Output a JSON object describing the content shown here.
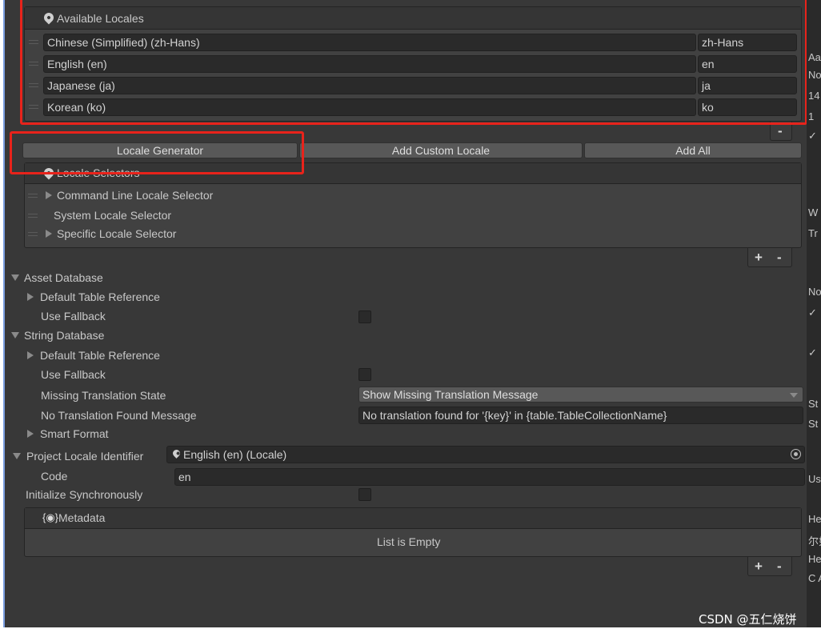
{
  "available_locales": {
    "title": "Available Locales",
    "items": [
      {
        "name": "Chinese (Simplified) (zh-Hans)",
        "code": "zh-Hans"
      },
      {
        "name": "English (en)",
        "code": "en"
      },
      {
        "name": "Japanese (ja)",
        "code": "ja"
      },
      {
        "name": "Korean (ko)",
        "code": "ko"
      }
    ],
    "minus": "-"
  },
  "buttons": {
    "locale_generator": "Locale Generator",
    "add_custom": "Add Custom Locale",
    "add_all": "Add All"
  },
  "locale_selectors": {
    "title": "Locale Selectors",
    "items": [
      "Command Line Locale Selector",
      "System Locale Selector",
      "Specific Locale Selector"
    ],
    "plus": "+",
    "minus": "-"
  },
  "asset_db": {
    "title": "Asset Database",
    "default_table": "Default Table Reference",
    "use_fallback": "Use Fallback"
  },
  "string_db": {
    "title": "String Database",
    "default_table": "Default Table Reference",
    "use_fallback": "Use Fallback",
    "missing_state_label": "Missing Translation State",
    "missing_state_value": "Show Missing Translation Message",
    "no_translation_label": "No Translation Found Message",
    "no_translation_value": "No translation found for '{key}' in {table.TableCollectionName}",
    "smart_format": "Smart Format"
  },
  "project_locale": {
    "label": "Project Locale Identifier",
    "value": "English (en) (Locale)",
    "code_label": "Code",
    "code_value": "en"
  },
  "init_sync": "Initialize Synchronously",
  "metadata": {
    "title": "Metadata",
    "empty": "List is Empty",
    "plus": "+",
    "minus": "-"
  },
  "side_fragments": [
    "Aa",
    "No",
    "14",
    "1",
    "✓",
    "W",
    "Tr",
    "No",
    "✓",
    "✓",
    "St",
    "St",
    "Us",
    "He",
    "尔如",
    "He",
    "C A"
  ],
  "watermark": "CSDN @五仁烧饼"
}
